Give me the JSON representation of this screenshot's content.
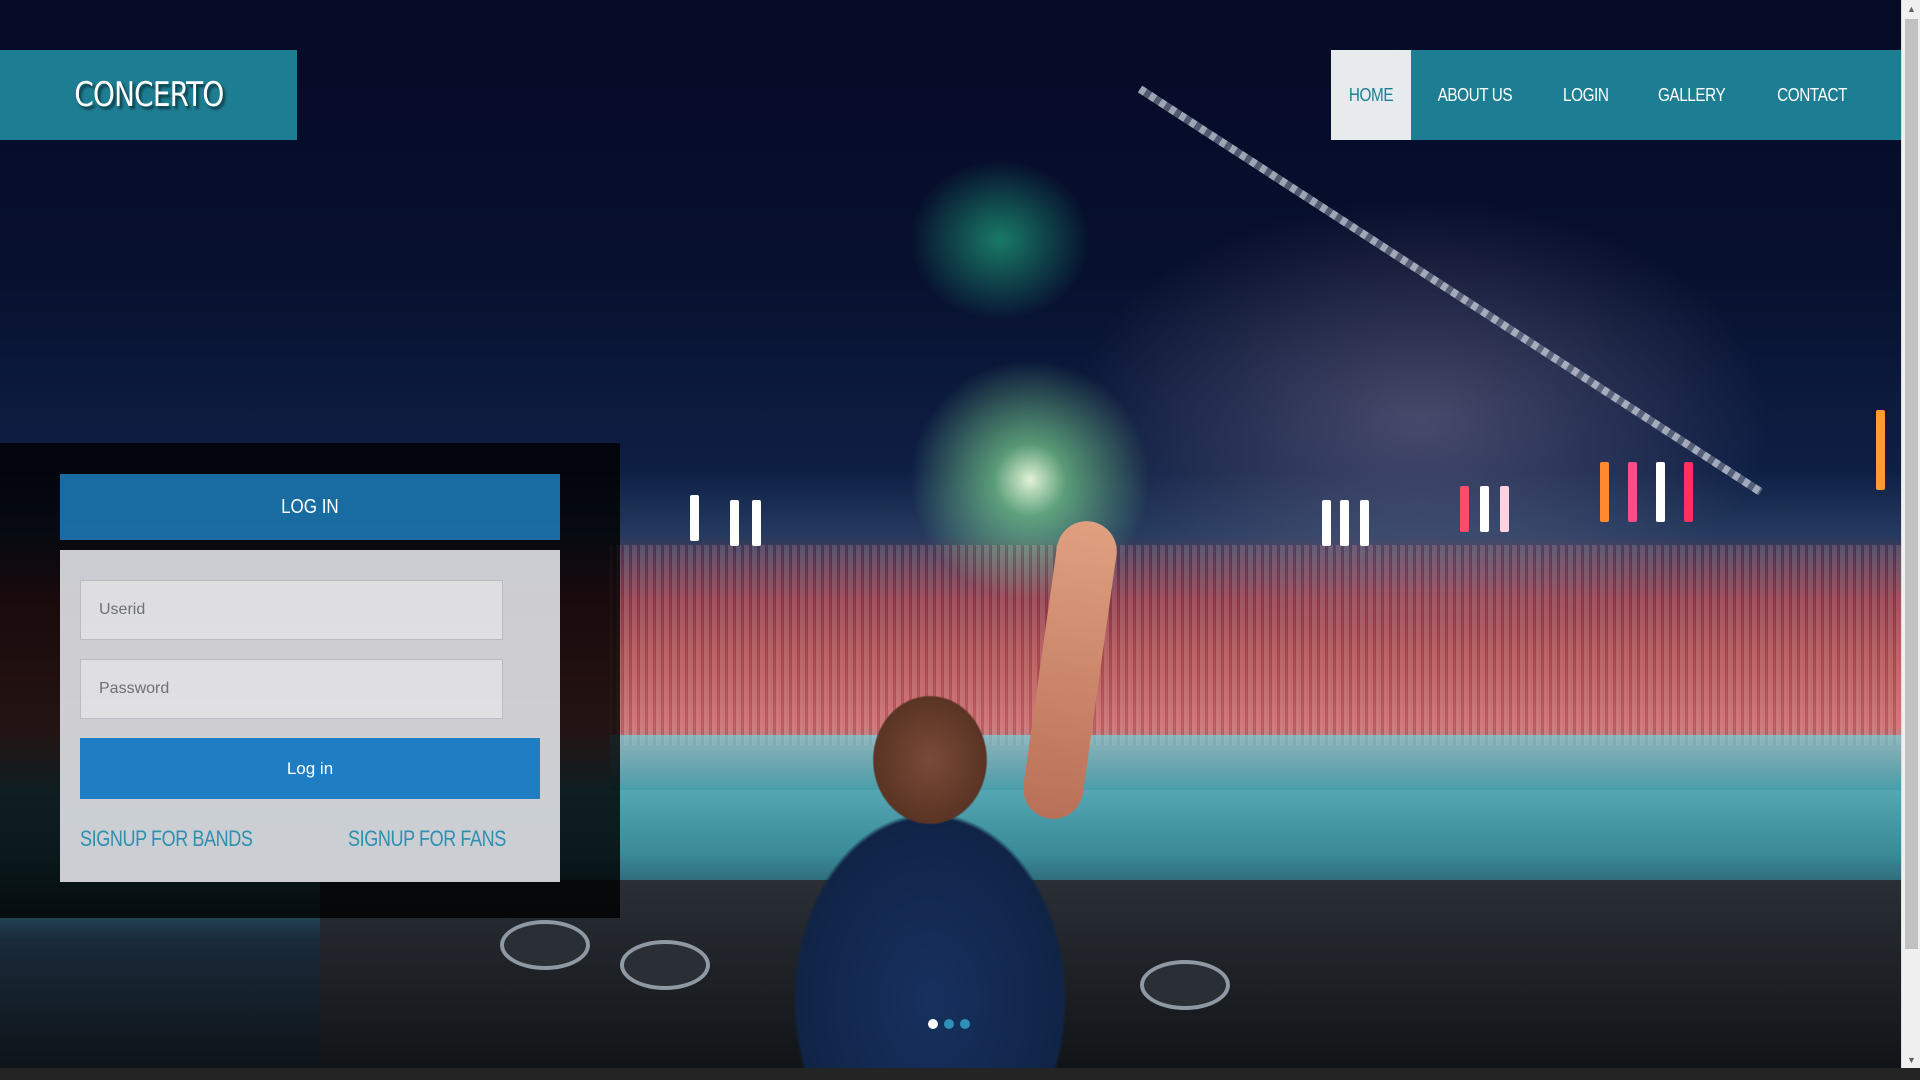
{
  "brand": {
    "logo": "CONCERTO"
  },
  "nav": {
    "items": [
      {
        "label": "HOME",
        "active": true
      },
      {
        "label": "ABOUT US",
        "active": false
      },
      {
        "label": "LOGIN",
        "active": false
      },
      {
        "label": "GALLERY",
        "active": false
      },
      {
        "label": "CONTACT",
        "active": false
      }
    ]
  },
  "login": {
    "title": "LOG IN",
    "userid_placeholder": "Userid",
    "password_placeholder": "Password",
    "submit_label": "Log in",
    "signup_bands": "SIGNUP FOR BANDS",
    "signup_fans": "SIGNUP FOR FANS"
  },
  "carousel": {
    "slide_count": 3,
    "active_index": 0
  },
  "colors": {
    "brand_teal": "#1d7d92",
    "login_blue": "#1f7ec3",
    "link_blue": "#2e8fb0",
    "active_nav_bg": "#e8ebee"
  },
  "icons": {
    "scroll_up": "scroll-up-arrow-icon",
    "scroll_down": "scroll-down-arrow-icon"
  }
}
